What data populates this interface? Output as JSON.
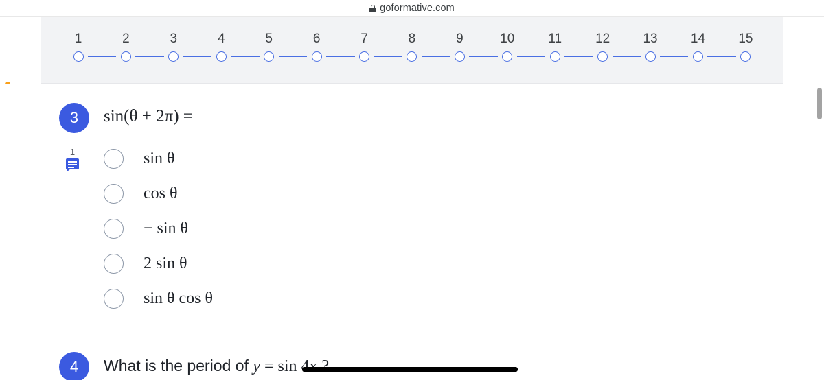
{
  "browser": {
    "url": "goformative.com",
    "lock_icon": "lock-icon"
  },
  "marker": {
    "dot_color": "#f9a01b"
  },
  "stepper": {
    "steps": [
      "1",
      "2",
      "3",
      "4",
      "5",
      "6",
      "7",
      "8",
      "9",
      "10",
      "11",
      "12",
      "13",
      "14",
      "15"
    ],
    "accent_color": "#4a6fe3",
    "panel_bg": "#f2f3f5",
    "clipped_fragments": [
      "....",
      "..",
      "..."
    ]
  },
  "questions": [
    {
      "number": "3",
      "prompt": "sin(θ + 2π) =",
      "comment_count": "1",
      "comment_icon": "comment-icon",
      "badge_color": "#3b5ae0",
      "options": [
        {
          "label": "sin θ",
          "selected": false
        },
        {
          "label": "cos θ",
          "selected": false
        },
        {
          "label": "− sin θ",
          "selected": false
        },
        {
          "label": "2 sin θ",
          "selected": false
        },
        {
          "label": "sin θ cos θ",
          "selected": false
        }
      ]
    },
    {
      "number": "4",
      "prompt_prefix": "What is the period of ",
      "prompt_var": "y",
      "prompt_eq": " = ",
      "prompt_expr": "sin 4x ?",
      "redacted": true
    }
  ],
  "scrollbar": {
    "thumb_color": "#a3a3a3"
  }
}
